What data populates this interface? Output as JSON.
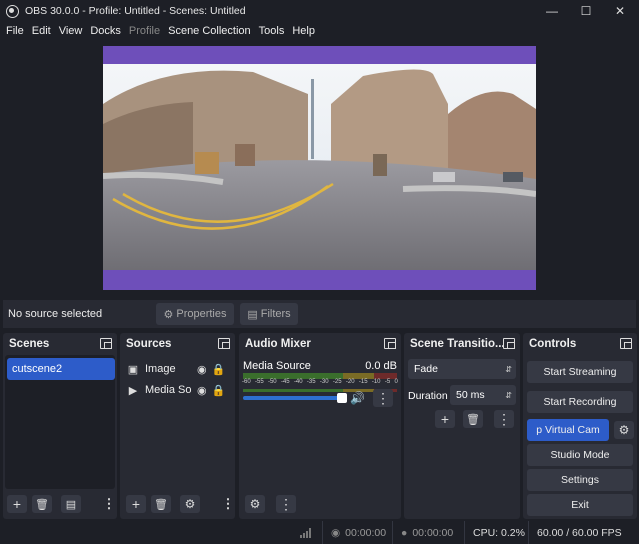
{
  "window": {
    "title": "OBS 30.0.0 - Profile: Untitled - Scenes: Untitled"
  },
  "menu": [
    "File",
    "Edit",
    "View",
    "Docks",
    "Profile",
    "Scene Collection",
    "Tools",
    "Help"
  ],
  "menu_disabled": [
    "Profile"
  ],
  "source_bar": {
    "status": "No source selected",
    "properties": "Properties",
    "filters": "Filters"
  },
  "scenes": {
    "title": "Scenes",
    "items": [
      "cutscene2"
    ]
  },
  "sources": {
    "title": "Sources",
    "items": [
      {
        "name": "Image",
        "icon": "image-icon"
      },
      {
        "name": "Media Source",
        "icon": "play-icon"
      }
    ]
  },
  "audio": {
    "title": "Audio Mixer",
    "channel": "Media Source",
    "level": "0.0 dB",
    "ticks": [
      "-60",
      "-55",
      "-50",
      "-45",
      "-40",
      "-35",
      "-30",
      "-25",
      "-20",
      "-15",
      "-10",
      "-5",
      "0"
    ]
  },
  "transitions": {
    "title": "Scene Transitio...",
    "type": "Fade",
    "duration_label": "Duration",
    "duration": "50 ms"
  },
  "controls": {
    "title": "Controls",
    "buttons": [
      "Start Streaming",
      "Start Recording",
      "p Virtual Cam",
      "Studio Mode",
      "Settings",
      "Exit"
    ]
  },
  "status": {
    "stream_time": "00:00:00",
    "rec_time": "00:00:00",
    "cpu": "CPU: 0.2%",
    "fps": "60.00 / 60.00 FPS"
  },
  "colors": {
    "accent": "#2d5cc9",
    "canvas_border": "#6e4fba",
    "bg": "#1d1f26",
    "panel": "#282a33"
  }
}
